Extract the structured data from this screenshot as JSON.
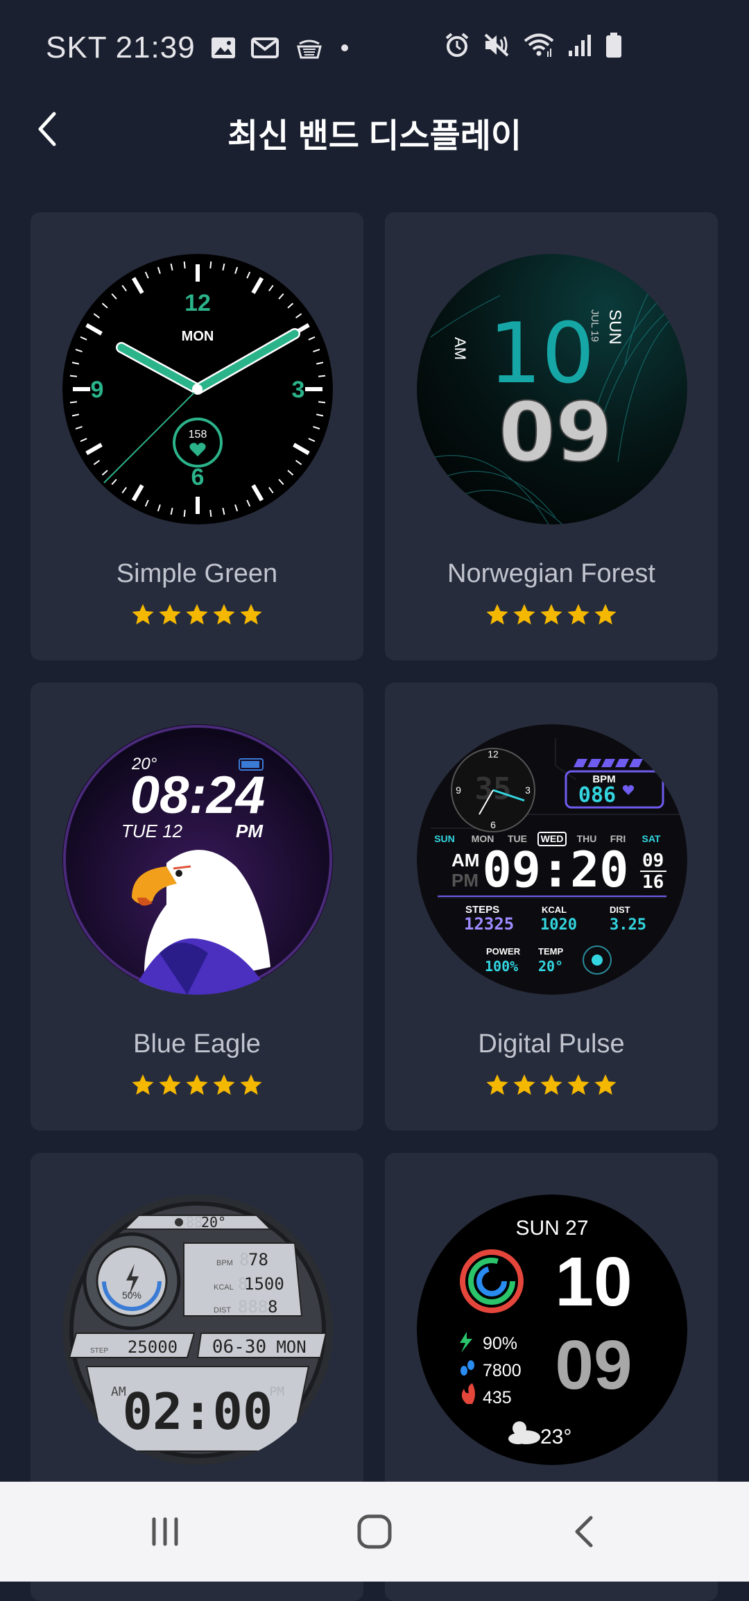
{
  "status_bar": {
    "carrier": "SKT",
    "time": "21:39",
    "left_icons": [
      "image-icon",
      "mail-icon",
      "amazon-icon",
      "dot-icon"
    ],
    "right_icons": [
      "alarm-icon",
      "mute-icon",
      "wifi-icon",
      "signal-icon",
      "battery-icon"
    ]
  },
  "header": {
    "title": "최신 밴드 디스플레이",
    "back_icon": "chevron-left-icon"
  },
  "watch_faces": [
    {
      "name": "Simple Green",
      "rating": 5,
      "dial": {
        "n12": "12",
        "n3": "3",
        "n6": "6",
        "n9": "9",
        "day": "MON",
        "heart": "158"
      }
    },
    {
      "name": "Norwegian Forest",
      "rating": 5,
      "dial": {
        "ampm": "AM",
        "hour": "10",
        "minute": "09",
        "day": "SUN",
        "date": "JUL 19"
      }
    },
    {
      "name": "Blue Eagle",
      "rating": 5,
      "dial": {
        "temp": "20°",
        "time": "08:24",
        "date": "TUE 12",
        "ampm": "PM"
      }
    },
    {
      "name": "Digital Pulse",
      "rating": 5,
      "dial": {
        "bpm_label": "BPM",
        "bpm": "086",
        "days": [
          "SUN",
          "MON",
          "TUE",
          "WED",
          "THU",
          "FRI",
          "SAT"
        ],
        "am": "AM",
        "pm": "PM",
        "time": "09:20",
        "month": "09",
        "day": "16",
        "steps_label": "STEPS",
        "steps": "12325",
        "kcal_label": "KCAL",
        "kcal": "1020",
        "dist_label": "DIST",
        "dist": "3.25",
        "power_label": "POWER",
        "power": "100%",
        "temp_label": "TEMP",
        "temp": "20°",
        "analog": {
          "n12": "12",
          "n3": "3",
          "n6": "6",
          "n9": "9",
          "ghost": "35"
        }
      }
    },
    {
      "name": "",
      "rating": 0,
      "dial": {
        "temp": "20°",
        "temp_ghost": "88",
        "battery": "50%",
        "bpm_label": "BPM",
        "bpm": "78",
        "bpm_ghost": "8",
        "kcal_label": "KCAL",
        "kcal": "1500",
        "kcal_ghost": "8",
        "dist_label": "DIST",
        "dist": "8",
        "dist_ghost": "888",
        "step_label": "STEP",
        "steps": "25000",
        "date": "06-30",
        "day": "MON",
        "am": "AM",
        "pm": "PM",
        "time": "02:00"
      }
    },
    {
      "name": "",
      "rating": 0,
      "dial": {
        "date": "SUN 27",
        "hour": "10",
        "minute": "09",
        "battery": "90%",
        "steps": "7800",
        "calories": "435",
        "temp": "23°"
      }
    }
  ],
  "nav_bar": {
    "icons": [
      "recent-apps-icon",
      "home-icon",
      "back-icon"
    ]
  },
  "colors": {
    "background": "#1b2030",
    "card": "#272c3c",
    "star": "#f5b800",
    "accent_green": "#2bb38a"
  }
}
